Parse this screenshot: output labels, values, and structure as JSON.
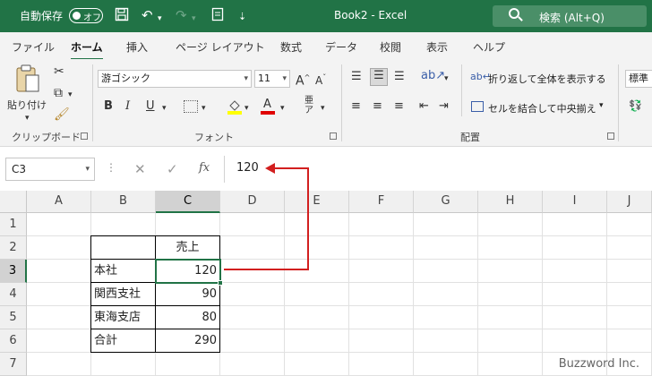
{
  "titlebar": {
    "autosave_label": "自動保存",
    "toggle_label": "オフ",
    "doc_title": "Book2  -  Excel",
    "search_placeholder": "検索 (Alt+Q)",
    "save_icon": "save-icon",
    "undo_icon": "undo-icon",
    "redo_icon": "redo-icon"
  },
  "tabs": [
    "ファイル",
    "ホーム",
    "挿入",
    "ページ レイアウト",
    "数式",
    "データ",
    "校閲",
    "表示",
    "ヘルプ"
  ],
  "active_tab": "ホーム",
  "ribbon": {
    "paste_label": "貼り付け",
    "clipboard_group": "クリップボード",
    "font_name": "游ゴシック",
    "font_size": "11",
    "font_group": "フォント",
    "bold": "B",
    "italic": "I",
    "underline": "U",
    "wrap_text": "折り返して全体を表示する",
    "merge_center": "セルを結合して中央揃え",
    "alignment_group": "配置",
    "number_format": "標準"
  },
  "formula_bar": {
    "name_box": "C3",
    "cancel_icon": "✕",
    "enter_icon": "✓",
    "fx_label": "fx",
    "content": "120"
  },
  "grid": {
    "columns": [
      "A",
      "B",
      "C",
      "D",
      "E",
      "F",
      "G",
      "H",
      "I",
      "J"
    ],
    "rows": [
      "1",
      "2",
      "3",
      "4",
      "5",
      "6",
      "7"
    ],
    "selected_cell": "C3",
    "cells": {
      "C2": "売上",
      "B3": "本社",
      "C3": "120",
      "B4": "関西支社",
      "C4": "90",
      "B5": "東海支店",
      "C5": "80",
      "B6": "合計",
      "C6": "290"
    }
  },
  "watermark": "Buzzword Inc.",
  "colors": {
    "brand": "#217346",
    "annotation": "#d21f1f"
  }
}
